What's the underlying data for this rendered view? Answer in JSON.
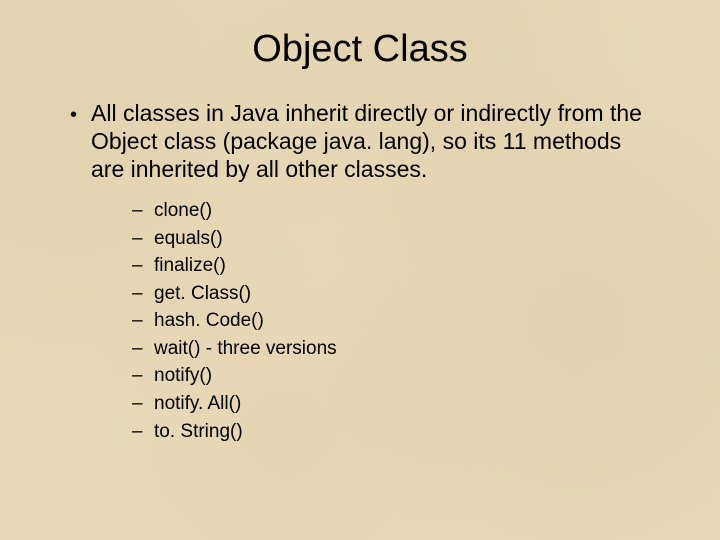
{
  "title": "Object Class",
  "main_bullet": {
    "marker": "•",
    "text": "All classes in Java inherit directly or indirectly from the Object class (package java. lang), so its 11 methods are inherited by all other classes."
  },
  "sub_items": {
    "dash": "–",
    "items": [
      "clone()",
      "equals()",
      "finalize()",
      "get. Class()",
      "hash. Code()",
      "wait() - three versions",
      "notify()",
      "notify. All()",
      "to. String()"
    ]
  }
}
